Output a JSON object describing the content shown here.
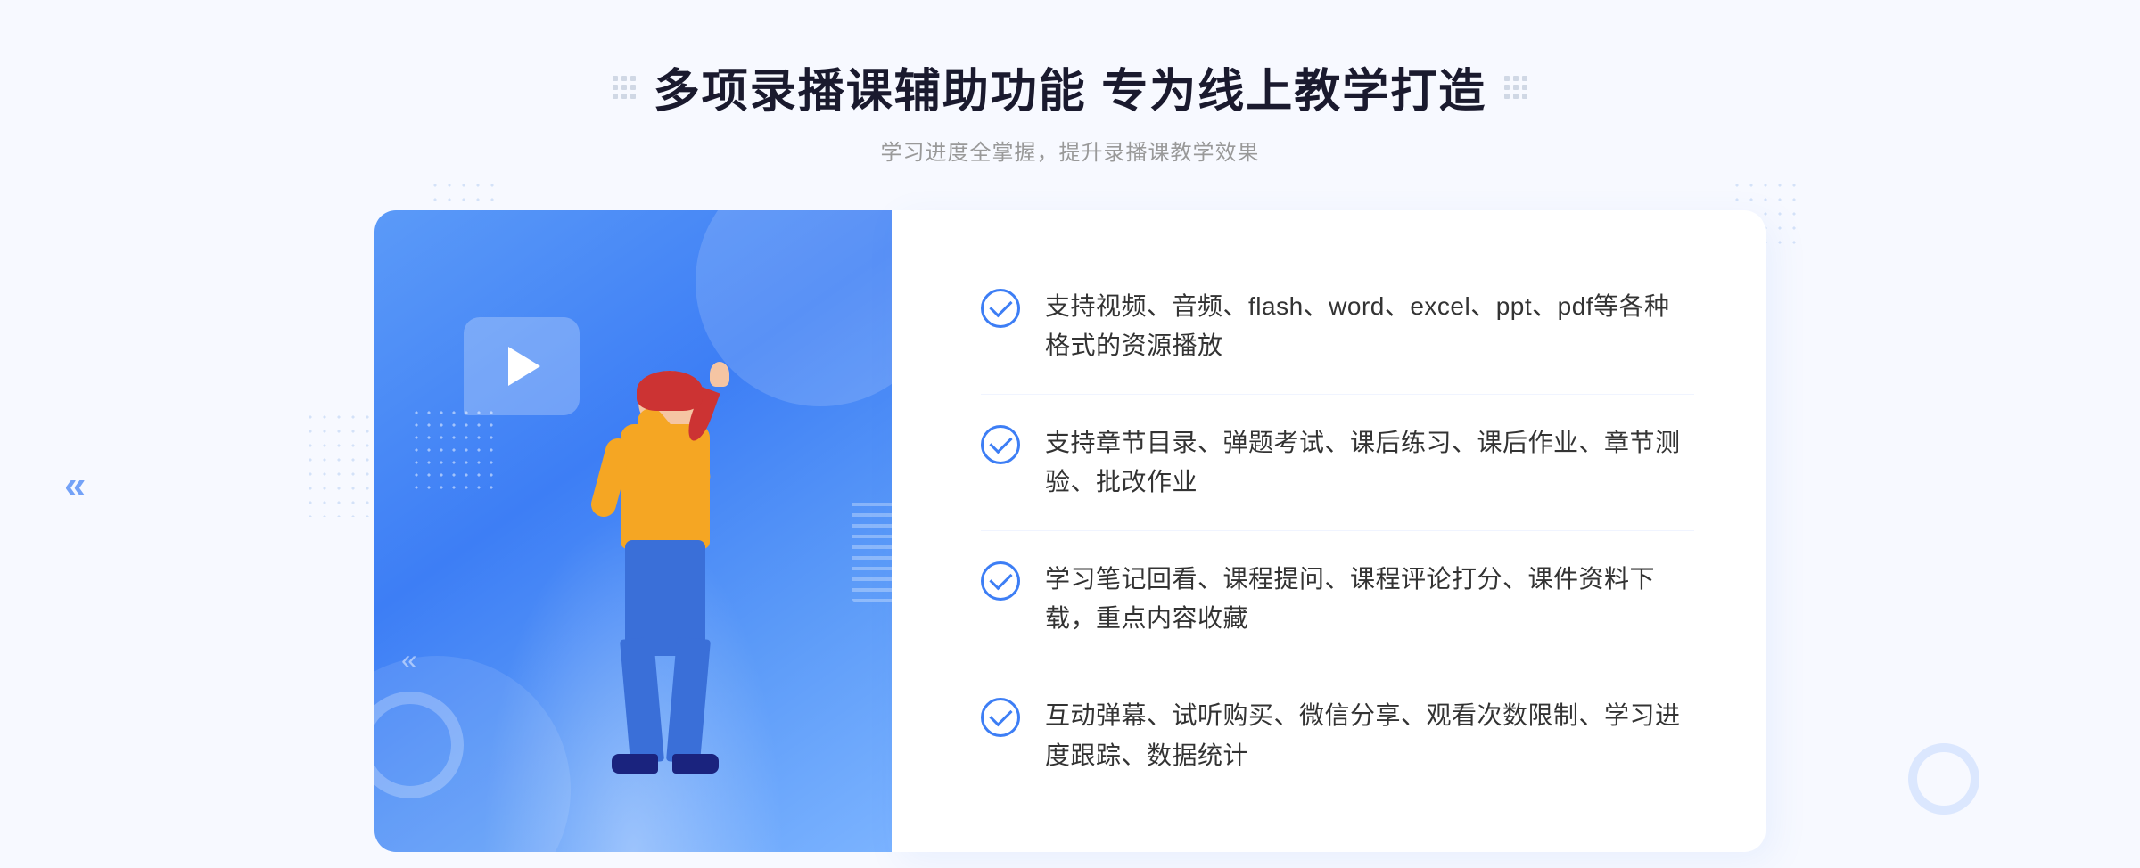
{
  "header": {
    "title": "多项录播课辅助功能 专为线上教学打造",
    "subtitle": "学习进度全掌握，提升录播课教学效果",
    "deco_left": "grid",
    "deco_right": "grid"
  },
  "features": [
    {
      "id": 1,
      "text": "支持视频、音频、flash、word、excel、ppt、pdf等各种格式的资源播放"
    },
    {
      "id": 2,
      "text": "支持章节目录、弹题考试、课后练习、课后作业、章节测验、批改作业"
    },
    {
      "id": 3,
      "text": "学习笔记回看、课程提问、课程评论打分、课件资料下载，重点内容收藏"
    },
    {
      "id": 4,
      "text": "互动弹幕、试听购买、微信分享、观看次数限制、学习进度跟踪、数据统计"
    }
  ],
  "colors": {
    "primary": "#3d7ef5",
    "primary_light": "#5b9af8",
    "title_dark": "#1a1a2e",
    "text_main": "#333333",
    "text_sub": "#999999",
    "bg_page": "#f7f9ff",
    "bg_white": "#ffffff"
  },
  "icons": {
    "check": "check-circle-icon",
    "play": "play-icon",
    "chevron_left": "chevron-left-icon",
    "grid_deco": "grid-decoration-icon"
  }
}
